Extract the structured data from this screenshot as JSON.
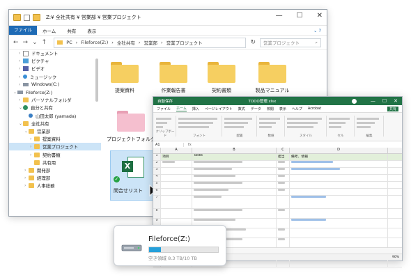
{
  "explorer": {
    "title": "Z:¥ 全社共有 ¥ 営業部 ¥ 営業プロジェクト",
    "ribbon_tabs": [
      "ファイル",
      "ホーム",
      "共有",
      "表示"
    ],
    "breadcrumb": [
      "PC",
      "Fileforce(Z:)",
      "全社共有",
      "営業部",
      "営業プロジェクト"
    ],
    "search_placeholder": "営業プロジェクト",
    "tree": [
      {
        "label": "ドキュメント",
        "icon": "doc"
      },
      {
        "label": "ピクチャ",
        "icon": "pic"
      },
      {
        "label": "ビデオ",
        "icon": "vid"
      },
      {
        "label": "ミュージック",
        "icon": "music"
      },
      {
        "label": "Windows(C:)",
        "icon": "drive"
      },
      {
        "label": "Fileforce(Z:)",
        "icon": "drive"
      },
      {
        "label": "パーソナルフォルダ",
        "icon": "folder"
      },
      {
        "label": "自分と共有",
        "icon": "grp"
      },
      {
        "label": "山田太郎 (yamada)",
        "icon": "user"
      },
      {
        "label": "全社共有",
        "icon": "folder"
      },
      {
        "label": "営業部",
        "icon": "folder"
      },
      {
        "label": "提案資料",
        "icon": "folder"
      },
      {
        "label": "営業プロジェクト",
        "icon": "folder"
      },
      {
        "label": "契約書類",
        "icon": "folder"
      },
      {
        "label": "共有用",
        "icon": "folder"
      },
      {
        "label": "開発部",
        "icon": "folder"
      },
      {
        "label": "経理部",
        "icon": "folder"
      },
      {
        "label": "人事総務",
        "icon": "folder"
      }
    ],
    "folders": [
      "提案資料",
      "作業報告書",
      "契約書類",
      "製品マニュアル",
      "プロジェクトフォルダ"
    ],
    "file_name": "問合せリスト"
  },
  "excel": {
    "title": "TODO管理.xlsx",
    "autosave": "自動保存",
    "tabs": [
      "ファイル",
      "ホーム",
      "挿入",
      "ページレイアウト",
      "数式",
      "データ",
      "校閲",
      "表示",
      "ヘルプ",
      "Acrobat"
    ],
    "share_label": "共有",
    "cell_ref": "A1",
    "fx": "fx",
    "columns": [
      "A",
      "B",
      "C",
      "D"
    ],
    "header_row": [
      "項目",
      "Tasks",
      "担当",
      "備考、情報"
    ],
    "rows": [
      "2",
      "3",
      "4",
      "5",
      "6",
      "7",
      "8",
      "9",
      "10",
      "11",
      "12",
      "13"
    ],
    "ribbon_groups": [
      "クリップボード",
      "フォント",
      "配置",
      "数値",
      "スタイル",
      "セル",
      "編集"
    ],
    "zoom": "90%"
  },
  "drive_card": {
    "name": "Fileforce(Z:)",
    "usage_fraction": 0.17,
    "free_text": "空き領域 8.3 TB/10 TB"
  },
  "colors": {
    "excel_green": "#217346",
    "folder_yellow": "#f6cf61",
    "selection_blue": "#cce4f7",
    "progress_blue": "#26a0da"
  }
}
